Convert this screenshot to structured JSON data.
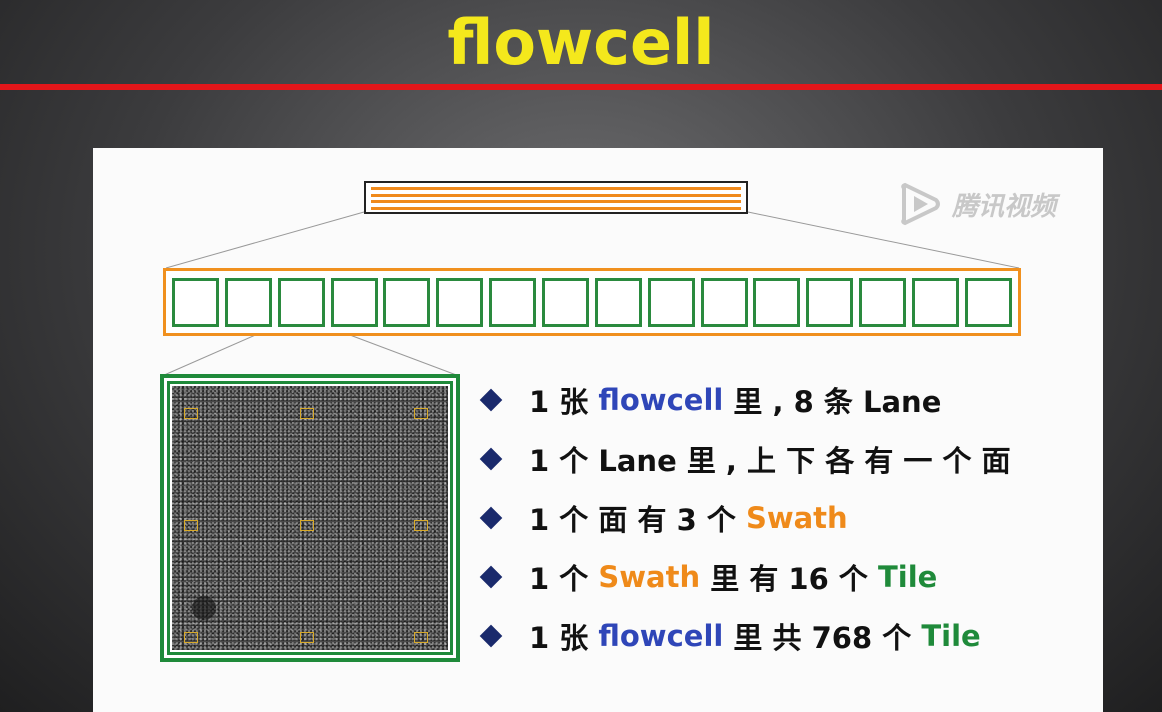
{
  "slide": {
    "title": "flowcell"
  },
  "watermark": {
    "logo_text": "腾讯视频"
  },
  "bullets": [
    {
      "parts": [
        {
          "text": "1 张 ",
          "color": "default"
        },
        {
          "text": "flowcell",
          "color": "blue"
        },
        {
          "text": " 里 , 8 条 Lane",
          "color": "default"
        }
      ]
    },
    {
      "parts": [
        {
          "text": "1 个 Lane 里 , 上 下 各 有 一 个 面",
          "color": "default"
        }
      ]
    },
    {
      "parts": [
        {
          "text": "1 个 面 有 3 个 ",
          "color": "default"
        },
        {
          "text": "Swath",
          "color": "orange"
        }
      ]
    },
    {
      "parts": [
        {
          "text": "1 个 ",
          "color": "default"
        },
        {
          "text": "Swath",
          "color": "orange"
        },
        {
          "text": " 里 有 16 个 ",
          "color": "default"
        },
        {
          "text": "Tile",
          "color": "green"
        }
      ]
    },
    {
      "parts": [
        {
          "text": "1 张 ",
          "color": "default"
        },
        {
          "text": "flowcell",
          "color": "blue"
        },
        {
          "text": " 里 共 768 个 ",
          "color": "default"
        },
        {
          "text": "Tile",
          "color": "green"
        }
      ]
    }
  ],
  "diagram": {
    "flowcell_stripe_count": 4,
    "tile_count": 16,
    "colors": {
      "title": "#f4e81c",
      "rule": "#e3161a",
      "lane_border": "#f0901e",
      "tile_border": "#2a8a3e",
      "bullet_diamond": "#1a2a6c",
      "blue": "#2f46b8",
      "orange": "#ef8a1a",
      "green": "#1f8a3a"
    }
  }
}
